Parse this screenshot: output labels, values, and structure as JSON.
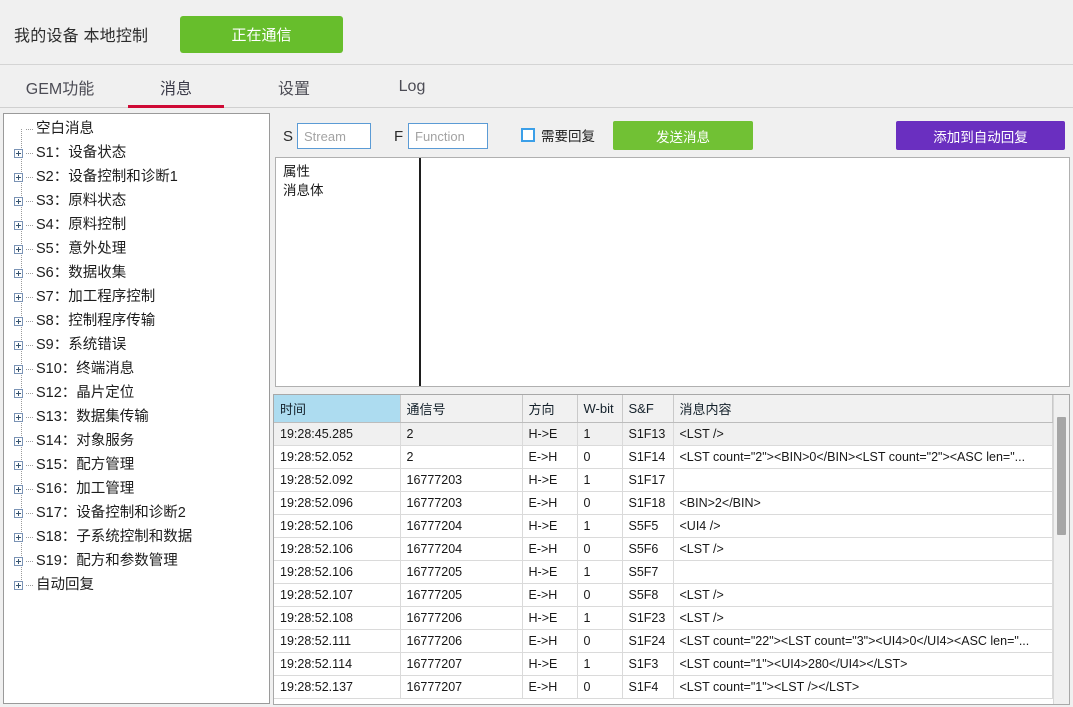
{
  "header": {
    "device_title": "我的设备 本地控制",
    "comm_status": "正在通信",
    "comm_status_color": "#67be2c"
  },
  "tabs": [
    {
      "label": "GEM功能",
      "active": false
    },
    {
      "label": "消息",
      "active": true
    },
    {
      "label": "设置",
      "active": false
    },
    {
      "label": "Log",
      "active": false
    }
  ],
  "tab_accent_color": "#cf0a35",
  "tree": {
    "items": [
      {
        "label": "空白消息",
        "expandable": false
      },
      {
        "label": "S1：设备状态",
        "expandable": true
      },
      {
        "label": "S2：设备控制和诊断1",
        "expandable": true
      },
      {
        "label": "S3：原料状态",
        "expandable": true
      },
      {
        "label": "S4：原料控制",
        "expandable": true
      },
      {
        "label": "S5：意外处理",
        "expandable": true
      },
      {
        "label": "S6：数据收集",
        "expandable": true
      },
      {
        "label": "S7：加工程序控制",
        "expandable": true
      },
      {
        "label": "S8：控制程序传输",
        "expandable": true
      },
      {
        "label": "S9：系统错误",
        "expandable": true
      },
      {
        "label": "S10：终端消息",
        "expandable": true
      },
      {
        "label": "S12：晶片定位",
        "expandable": true
      },
      {
        "label": "S13：数据集传输",
        "expandable": true
      },
      {
        "label": "S14：对象服务",
        "expandable": true
      },
      {
        "label": "S15：配方管理",
        "expandable": true
      },
      {
        "label": "S16：加工管理",
        "expandable": true
      },
      {
        "label": "S17：设备控制和诊断2",
        "expandable": true
      },
      {
        "label": "S18：子系统控制和数据",
        "expandable": true
      },
      {
        "label": "S19：配方和参数管理",
        "expandable": true
      },
      {
        "label": "自动回复",
        "expandable": true
      }
    ]
  },
  "toolbar": {
    "stream_prefix": "S",
    "stream_value": "",
    "stream_placeholder": "Stream",
    "function_prefix": "F",
    "function_value": "",
    "function_placeholder": "Function",
    "need_reply_label": "需要回复",
    "need_reply_checked": false,
    "send_label": "发送消息",
    "send_color": "#71c134",
    "add_autoreply_label": "添加到自动回复",
    "add_autoreply_color": "#6a2fc0"
  },
  "editor": {
    "nodes": [
      "属性",
      "消息体"
    ],
    "body_value": ""
  },
  "log_table": {
    "columns": [
      "时间",
      "通信号",
      "方向",
      "W-bit",
      "S&F",
      "消息内容"
    ],
    "sorted_column": "时间",
    "rows": [
      {
        "time": "19:28:45.285",
        "comm": "2",
        "dir": "H->E",
        "wbit": "1",
        "snf": "S1F13",
        "msg": "<LST />"
      },
      {
        "time": "19:28:52.052",
        "comm": "2",
        "dir": "E->H",
        "wbit": "0",
        "snf": "S1F14",
        "msg": "<LST count=\"2\"><BIN>0</BIN><LST count=\"2\"><ASC len=\"..."
      },
      {
        "time": "19:28:52.092",
        "comm": "16777203",
        "dir": "H->E",
        "wbit": "1",
        "snf": "S1F17",
        "msg": ""
      },
      {
        "time": "19:28:52.096",
        "comm": "16777203",
        "dir": "E->H",
        "wbit": "0",
        "snf": "S1F18",
        "msg": "<BIN>2</BIN>"
      },
      {
        "time": "19:28:52.106",
        "comm": "16777204",
        "dir": "H->E",
        "wbit": "1",
        "snf": "S5F5",
        "msg": "<UI4 />"
      },
      {
        "time": "19:28:52.106",
        "comm": "16777204",
        "dir": "E->H",
        "wbit": "0",
        "snf": "S5F6",
        "msg": "<LST />"
      },
      {
        "time": "19:28:52.106",
        "comm": "16777205",
        "dir": "H->E",
        "wbit": "1",
        "snf": "S5F7",
        "msg": ""
      },
      {
        "time": "19:28:52.107",
        "comm": "16777205",
        "dir": "E->H",
        "wbit": "0",
        "snf": "S5F8",
        "msg": "<LST />"
      },
      {
        "time": "19:28:52.108",
        "comm": "16777206",
        "dir": "H->E",
        "wbit": "1",
        "snf": "S1F23",
        "msg": "<LST />"
      },
      {
        "time": "19:28:52.111",
        "comm": "16777206",
        "dir": "E->H",
        "wbit": "0",
        "snf": "S1F24",
        "msg": "<LST count=\"22\"><LST count=\"3\"><UI4>0</UI4><ASC len=\"..."
      },
      {
        "time": "19:28:52.114",
        "comm": "16777207",
        "dir": "H->E",
        "wbit": "1",
        "snf": "S1F3",
        "msg": "<LST count=\"1\"><UI4>280</UI4></LST>"
      },
      {
        "time": "19:28:52.137",
        "comm": "16777207",
        "dir": "E->H",
        "wbit": "0",
        "snf": "S1F4",
        "msg": "<LST count=\"1\"><LST /></LST>"
      }
    ]
  }
}
